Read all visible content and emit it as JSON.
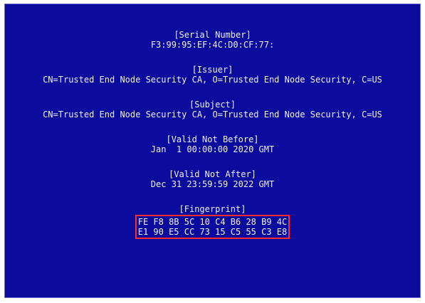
{
  "sections": [
    {
      "label": "[Serial Number]",
      "value": "F3:99:95:EF:4C:D0:CF:77:"
    },
    {
      "label": "[Issuer]",
      "value": "CN=Trusted End Node Security CA, O=Trusted End Node Security, C=US"
    },
    {
      "label": "[Subject]",
      "value": "CN=Trusted End Node Security CA, O=Trusted End Node Security, C=US"
    },
    {
      "label": "[Valid Not Before]",
      "value": "Jan  1 00:00:00 2020 GMT"
    },
    {
      "label": "[Valid Not After]",
      "value": "Dec 31 23:59:59 2022 GMT"
    }
  ],
  "fingerprint": {
    "label": "[Fingerprint]",
    "lines": [
      "FE F8 8B 5C 10 C4 B6 28 B9 4C",
      "E1 90 E5 CC 73 15 C5 55 C3 E8"
    ]
  },
  "colors": {
    "background": "#0b0c9e",
    "text": "#f0f0f0",
    "highlight_border": "#ff2a2a"
  }
}
